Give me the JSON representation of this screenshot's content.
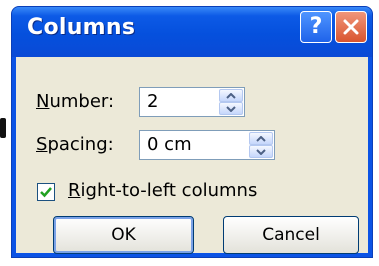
{
  "dialog": {
    "title": "Columns",
    "help_glyph": "?",
    "number": {
      "label_accel": "N",
      "label_rest": "umber:",
      "value": "2"
    },
    "spacing": {
      "label_accel": "S",
      "label_rest": "pacing:",
      "value": "0 cm"
    },
    "rtl": {
      "label_accel": "R",
      "label_rest": "ight-to-left columns",
      "checked": true
    },
    "ok_label": "OK",
    "cancel_label": "Cancel"
  },
  "icons": {
    "help": "help-icon",
    "close": "close-icon",
    "spin_up": "spin-up-icon",
    "spin_down": "spin-down-icon",
    "check": "check-icon"
  },
  "colors": {
    "titlebar": "#0550dd",
    "close": "#d9542f",
    "client": "#ece9d8",
    "check": "#21a121"
  }
}
